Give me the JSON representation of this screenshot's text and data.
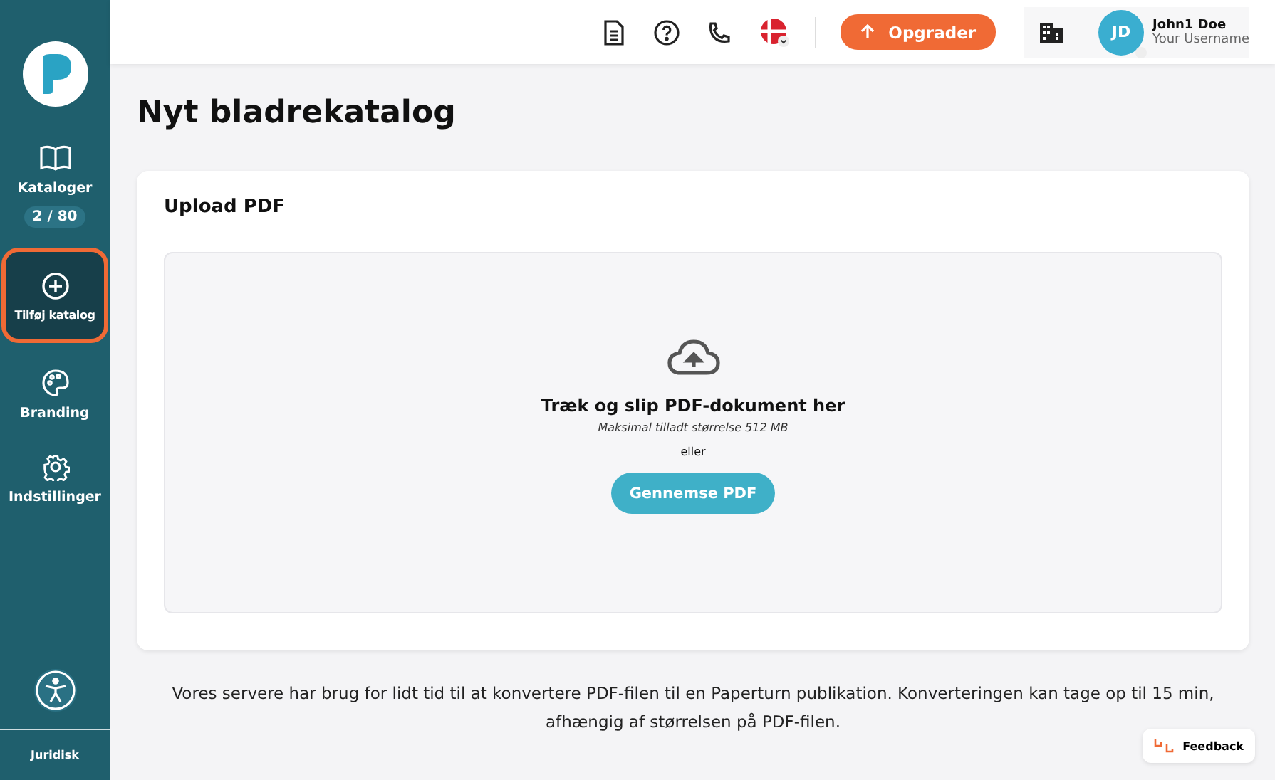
{
  "sidebar": {
    "items": [
      {
        "kind": "book",
        "label": "Kataloger",
        "badge": "2 / 80",
        "selected": false
      },
      {
        "kind": "add",
        "label": "Tilføj katalog",
        "selected": true
      },
      {
        "kind": "palette",
        "label": "Branding",
        "selected": false
      },
      {
        "kind": "gear",
        "label": "Indstillinger",
        "selected": false
      }
    ],
    "footer": "Juridisk"
  },
  "header": {
    "upgrade": "Opgrader",
    "avatar": "JD",
    "user_name": "John1 Doe",
    "username": "Your Username"
  },
  "page_title": "Nyt bladrekatalog",
  "upload": {
    "title": "Upload PDF",
    "drop_text": "Træk og slip PDF-dokument her",
    "max_size": "Maksimal tilladt størrelse 512 MB",
    "or": "eller",
    "browse": "Gennemse PDF"
  },
  "note": "Vores servere har brug for lidt tid til at konvertere PDF-filen til en Paperturn publikation. Konverteringen kan tage op til 15 min, afhængig af størrelsen på PDF-filen.",
  "feedback": "Feedback"
}
